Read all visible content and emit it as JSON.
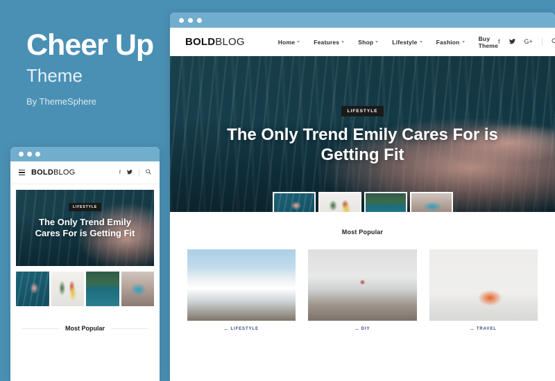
{
  "promo": {
    "title": "Cheer Up",
    "subtitle": "Theme",
    "byline": "By ThemeSphere"
  },
  "colors": {
    "background": "#4a90b5",
    "titlebar": "#71aece",
    "category_text": "#3d4a7a",
    "badge_bg": "#1a1a1a"
  },
  "desktop": {
    "logo_bold": "BOLD",
    "logo_light": "BLOG",
    "menu": [
      {
        "label": "Home",
        "has_dropdown": true
      },
      {
        "label": "Features",
        "has_dropdown": true
      },
      {
        "label": "Shop",
        "has_dropdown": true
      },
      {
        "label": "Lifestyle",
        "has_dropdown": true
      },
      {
        "label": "Fashion",
        "has_dropdown": true
      },
      {
        "label": "Buy Theme",
        "has_dropdown": false
      }
    ],
    "social": [
      {
        "name": "facebook-icon",
        "glyph": "f"
      },
      {
        "name": "twitter-icon",
        "glyph": "✉"
      },
      {
        "name": "googleplus-icon",
        "glyph": "G+"
      }
    ],
    "search_glyph": "⚲",
    "hero": {
      "badge": "LIFESTYLE",
      "title": "The Only Trend Emily Cares For is Getting Fit"
    },
    "thumbnails": [
      {
        "alt": "swimmer-in-blue-water"
      },
      {
        "alt": "plant-and-chair-interior"
      },
      {
        "alt": "tropical-lagoon-palms"
      },
      {
        "alt": "woman-by-swimming-pool"
      }
    ],
    "most_popular_title": "Most Popular",
    "cards": [
      {
        "category": "LIFESTYLE",
        "alt": "snowy-mountain-range"
      },
      {
        "category": "DIY",
        "alt": "person-on-coastal-rocks"
      },
      {
        "category": "TRAVEL",
        "alt": "orange-armchair-with-lamp"
      }
    ]
  },
  "mobile": {
    "logo_bold": "BOLD",
    "logo_light": "BLOG",
    "menu_icon": "hamburger-icon",
    "social": [
      {
        "name": "facebook-icon",
        "glyph": "f"
      },
      {
        "name": "twitter-icon",
        "glyph": "✉"
      }
    ],
    "search_glyph": "⚲",
    "hero": {
      "badge": "LIFESTYLE",
      "title": "The Only Trend Emily Cares For is Getting Fit"
    },
    "thumbnails": [
      {
        "alt": "swimmer-in-blue-water"
      },
      {
        "alt": "plant-and-chair-interior"
      },
      {
        "alt": "tropical-lagoon-palms"
      },
      {
        "alt": "woman-by-swimming-pool"
      }
    ],
    "most_popular_title": "Most Popular"
  }
}
